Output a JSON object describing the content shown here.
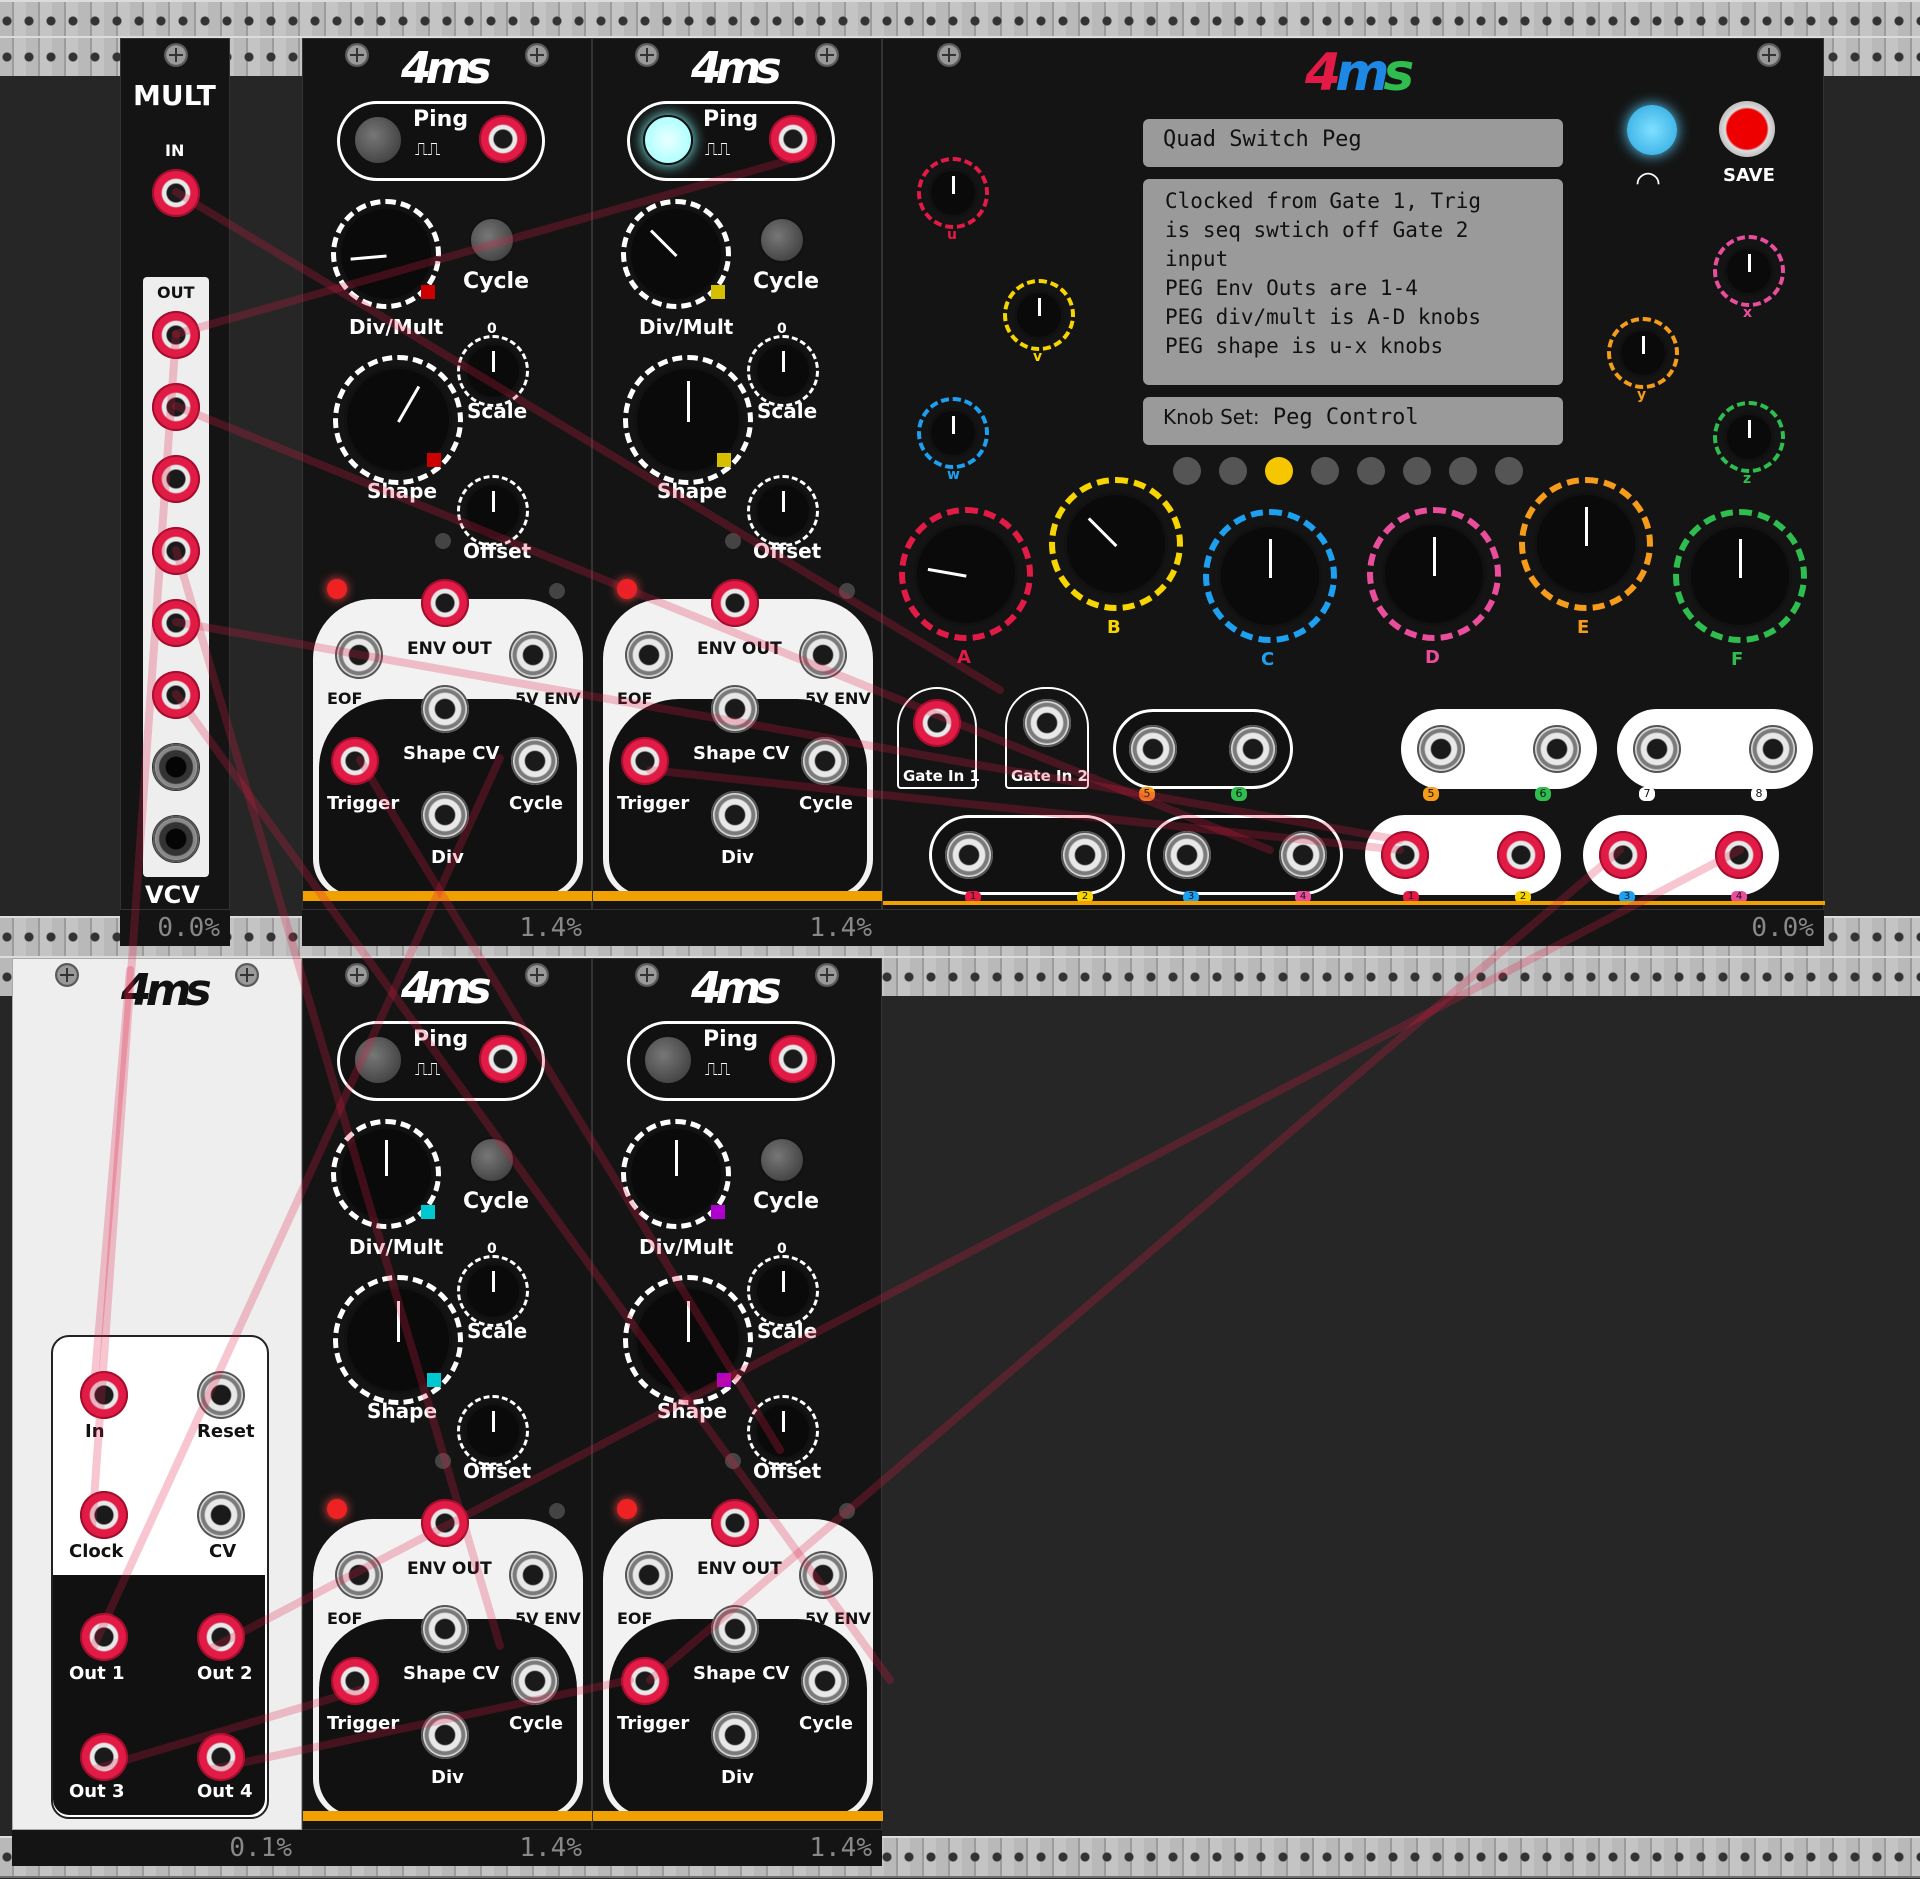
{
  "strip_readouts": [
    "0.0%",
    "1.4%",
    "1.4%",
    "0.0%",
    "0.1%",
    "1.4%",
    "1.4%"
  ],
  "mult": {
    "title": "MULT",
    "in_label": "IN",
    "out_label": "OUT",
    "footer": "VCV"
  },
  "peg_labels": {
    "ping": "Ping",
    "cycle": "Cycle",
    "divmult": "Div/Mult",
    "scale": "Scale",
    "shape": "Shape",
    "offset": "Offset",
    "envout": "ENV OUT",
    "eof": "EOF",
    "env5v": "5V ENV",
    "shapecv": "Shape CV",
    "trigger": "Trigger",
    "cyclej": "Cycle",
    "div": "Div",
    "zero": "0",
    "plus": "+",
    "minus": "-"
  },
  "qsp": {
    "title": "Quad Switch Peg",
    "description_lines": [
      "Clocked from Gate 1, Trig",
      "is seq swtich off Gate 2",
      "input",
      "PEG Env Outs are 1-4",
      "PEG div/mult is A-D knobs",
      "PEG shape is u-x knobs"
    ],
    "knobset_label": "Knob Set:",
    "knobset_value": "Peg Control",
    "save": "SAVE",
    "small_knobs": [
      "u",
      "v",
      "w",
      "x",
      "y",
      "z"
    ],
    "big_knobs": [
      "A",
      "B",
      "C",
      "D",
      "E",
      "F"
    ],
    "gate_in_1": "Gate In 1",
    "gate_in_2": "Gate In 2",
    "badges_top": [
      "5",
      "6",
      "5",
      "6",
      "7",
      "8"
    ],
    "badges_bottom": [
      "1",
      "2",
      "3",
      "4",
      "1",
      "2",
      "3",
      "4"
    ]
  },
  "clock": {
    "in": "In",
    "reset": "Reset",
    "clock": "Clock",
    "cv": "CV",
    "out1": "Out 1",
    "out2": "Out 2",
    "out3": "Out 3",
    "out4": "Out 4"
  },
  "colors": {
    "cable": "#e11b45",
    "accent_red": "#e11b45",
    "lcd": "#9a9a9a",
    "led_blue": "#5ad0ff"
  }
}
